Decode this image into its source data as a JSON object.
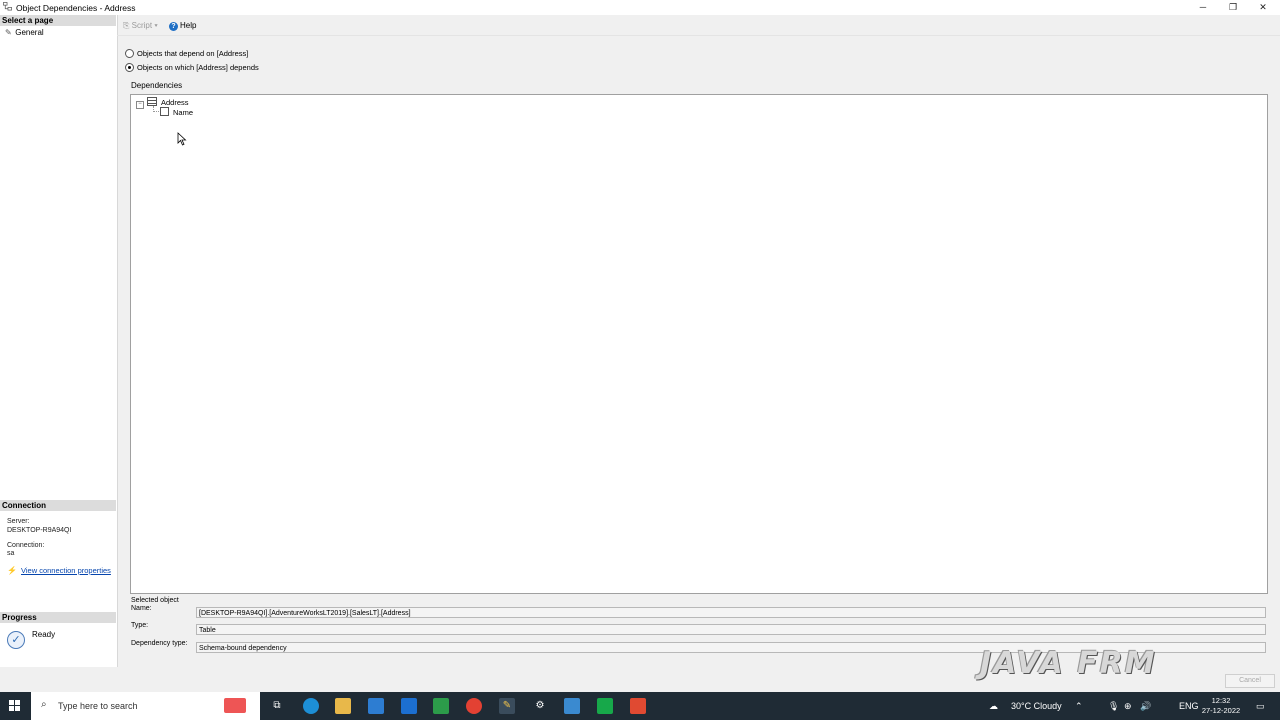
{
  "window": {
    "title": "Object Dependencies - Address",
    "controls": {
      "minimize": "─",
      "restore": "❐",
      "close": "✕"
    }
  },
  "left_pane": {
    "select_page_header": "Select a page",
    "pages": [
      {
        "label": "General"
      }
    ],
    "connection_header": "Connection",
    "server_label": "Server:",
    "server_value": "DESKTOP-R9A94QI",
    "connection_label": "Connection:",
    "connection_value": "sa",
    "view_connection_properties": "View connection properties",
    "progress_header": "Progress",
    "progress_status": "Ready"
  },
  "toolbar": {
    "script_label": "Script",
    "help_label": "Help"
  },
  "options": {
    "depend_on": "Objects that depend on [Address]",
    "depends": "Objects on which [Address] depends",
    "selected": "depends"
  },
  "dependencies": {
    "label": "Dependencies",
    "tree": {
      "root": "Address",
      "children": [
        "Name"
      ]
    }
  },
  "selected_object": {
    "group_label": "Selected object",
    "name_label": "Name:",
    "name_value": "[DESKTOP-R9A94QI].[AdventureWorksLT2019].[SalesLT].[Address]",
    "type_label": "Type:",
    "type_value": "Table",
    "dependency_type_label": "Dependency type:",
    "dependency_type_value": "Schema-bound dependency"
  },
  "buttons": {
    "cancel": "Cancel"
  },
  "watermark": "JAVA FRM",
  "taskbar": {
    "search_placeholder": "Type here to search",
    "weather": "30°C Cloudy",
    "language": "ENG",
    "time": "12:32",
    "date": "27-12-2022"
  }
}
